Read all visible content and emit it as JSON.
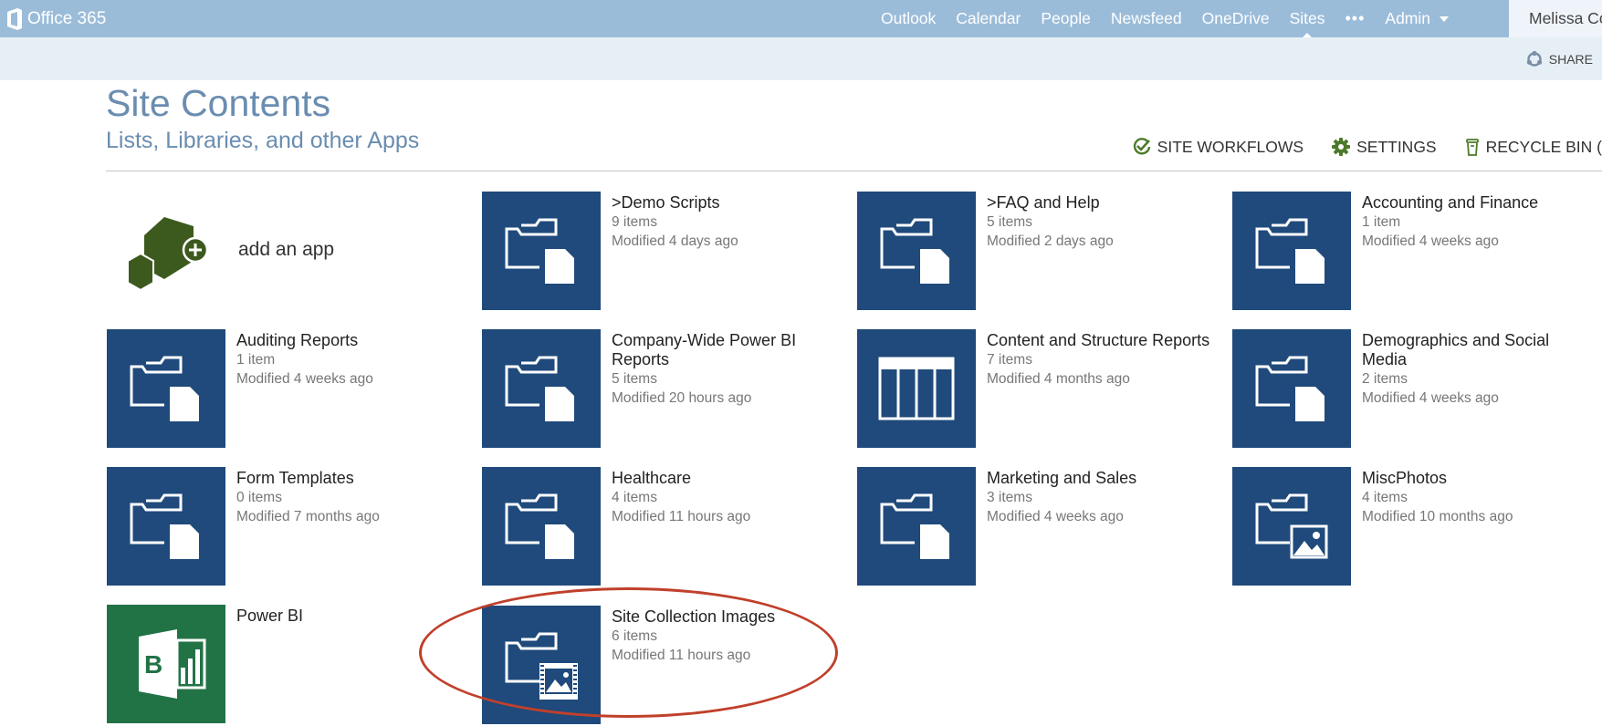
{
  "suitebar": {
    "brand": "Office 365",
    "nav": [
      "Outlook",
      "Calendar",
      "People",
      "Newsfeed",
      "OneDrive",
      "Sites"
    ],
    "more": "•••",
    "admin": "Admin",
    "user": "Melissa Co"
  },
  "ribbon": {
    "share": "SHARE"
  },
  "page": {
    "title": "Site Contents",
    "subtitle": "Lists, Libraries, and other Apps",
    "actions": {
      "workflows": "SITE WORKFLOWS",
      "settings": "SETTINGS",
      "recycle": "RECYCLE BIN ("
    }
  },
  "add_app": {
    "label": "add an app"
  },
  "tiles": [
    {
      "name": ">Demo Scripts",
      "count": "9 items",
      "modified": "Modified 4 days ago",
      "icon": "folder-doc-icon"
    },
    {
      "name": ">FAQ and Help",
      "count": "5 items",
      "modified": "Modified 2 days ago",
      "icon": "folder-doc-icon"
    },
    {
      "name": "Accounting and Finance",
      "count": "1 item",
      "modified": "Modified 4 weeks ago",
      "icon": "folder-doc-icon"
    },
    {
      "name": "Auditing Reports",
      "count": "1 item",
      "modified": "Modified 4 weeks ago",
      "icon": "folder-doc-icon"
    },
    {
      "name": "Company-Wide Power BI Reports",
      "count": "5 items",
      "modified": "Modified 20 hours ago",
      "icon": "folder-doc-icon"
    },
    {
      "name": "Content and Structure Reports",
      "count": "7 items",
      "modified": "Modified 4 months ago",
      "icon": "list-icon"
    },
    {
      "name": "Demographics and Social Media",
      "count": "2 items",
      "modified": "Modified 4 weeks ago",
      "icon": "folder-doc-icon"
    },
    {
      "name": "Form Templates",
      "count": "0 items",
      "modified": "Modified 7 months ago",
      "icon": "folder-doc-icon"
    },
    {
      "name": "Healthcare",
      "count": "4 items",
      "modified": "Modified 11 hours ago",
      "icon": "folder-doc-icon"
    },
    {
      "name": "Marketing and Sales",
      "count": "3 items",
      "modified": "Modified 4 weeks ago",
      "icon": "folder-doc-icon"
    },
    {
      "name": "MiscPhotos",
      "count": "4 items",
      "modified": "Modified 10 months ago",
      "icon": "folder-picture-icon"
    },
    {
      "name": "Power BI",
      "count": "",
      "modified": "",
      "icon": "power-bi-icon"
    },
    {
      "name": "Site Collection Images",
      "count": "6 items",
      "modified": "Modified 11 hours ago",
      "icon": "folder-image-film-icon"
    }
  ],
  "colors": {
    "tile": "#1f4a7b",
    "powerbi": "#217346",
    "highlight": "#c0402b",
    "suitebar": "#9bbcd9"
  }
}
